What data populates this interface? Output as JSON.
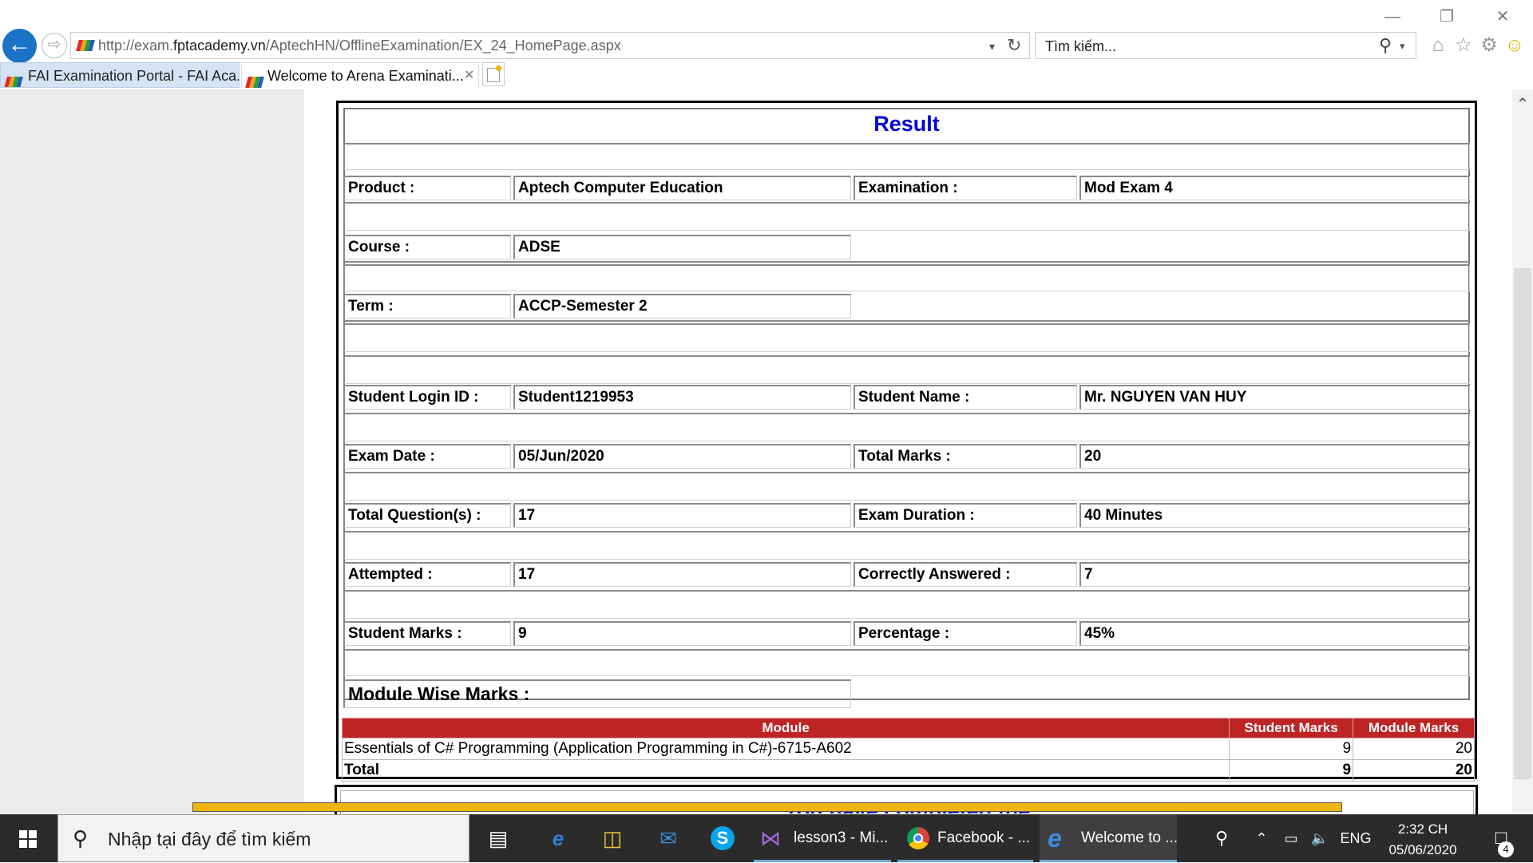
{
  "browser": {
    "url_prefix": "http://exam.",
    "url_domain": "fptacademy.vn",
    "url_path": "/AptechHN/OfflineExamination/EX_24_HomePage.aspx",
    "search_placeholder": "Tìm kiếm...",
    "tabs": [
      {
        "label": "FAI Examination Portal - FAI Aca..."
      },
      {
        "label": "Welcome to Arena Examinati..."
      }
    ]
  },
  "result": {
    "title": "Result",
    "rows": [
      {
        "label1": "Product :",
        "value1": "Aptech Computer Education",
        "label2": "Examination :",
        "value2": "Mod Exam 4"
      },
      {
        "label1": "Course :",
        "value1": "ADSE"
      },
      {
        "label1": "Term :",
        "value1": "ACCP-Semester 2"
      },
      {
        "label1": "Student Login ID :",
        "value1": "Student1219953",
        "label2": "Student Name :",
        "value2": "Mr. NGUYEN VAN HUY"
      },
      {
        "label1": "Exam Date :",
        "value1": "05/Jun/2020",
        "label2": "Total Marks :",
        "value2": "20"
      },
      {
        "label1": "Total Question(s) :",
        "value1": "17",
        "label2": "Exam Duration :",
        "value2": "40 Minutes"
      },
      {
        "label1": "Attempted :",
        "value1": "17",
        "label2": "Correctly Answered :",
        "value2": "7"
      },
      {
        "label1": "Student Marks :",
        "value1": "9",
        "label2": "Percentage :",
        "value2": "45%"
      }
    ],
    "module_wise_label": "Module Wise Marks :",
    "module_table": {
      "headers": [
        "Module",
        "Student Marks",
        "Module Marks"
      ],
      "rows": [
        {
          "module": "Essentials of C# Programming (Application Programming in C#)-6715-A602",
          "student_marks": "9",
          "module_marks": "20"
        }
      ],
      "total": {
        "label": "Total",
        "student_marks": "9",
        "module_marks": "20"
      }
    },
    "next_section_title": "You have completed the"
  },
  "taskbar": {
    "search_placeholder": "Nhập tại đây để tìm kiếm",
    "apps": [
      {
        "label": "lesson3 - Mi..."
      },
      {
        "label": "Facebook - ..."
      },
      {
        "label": "Welcome to ..."
      }
    ],
    "language": "ENG",
    "time": "2:32 CH",
    "date": "05/06/2020",
    "notification_count": "4"
  },
  "colors": {
    "accent_blue": "#0000d8",
    "table_header_red": "#bf2424",
    "progress_yellow": "#f1b511",
    "taskbar": "#2b2b2b"
  }
}
